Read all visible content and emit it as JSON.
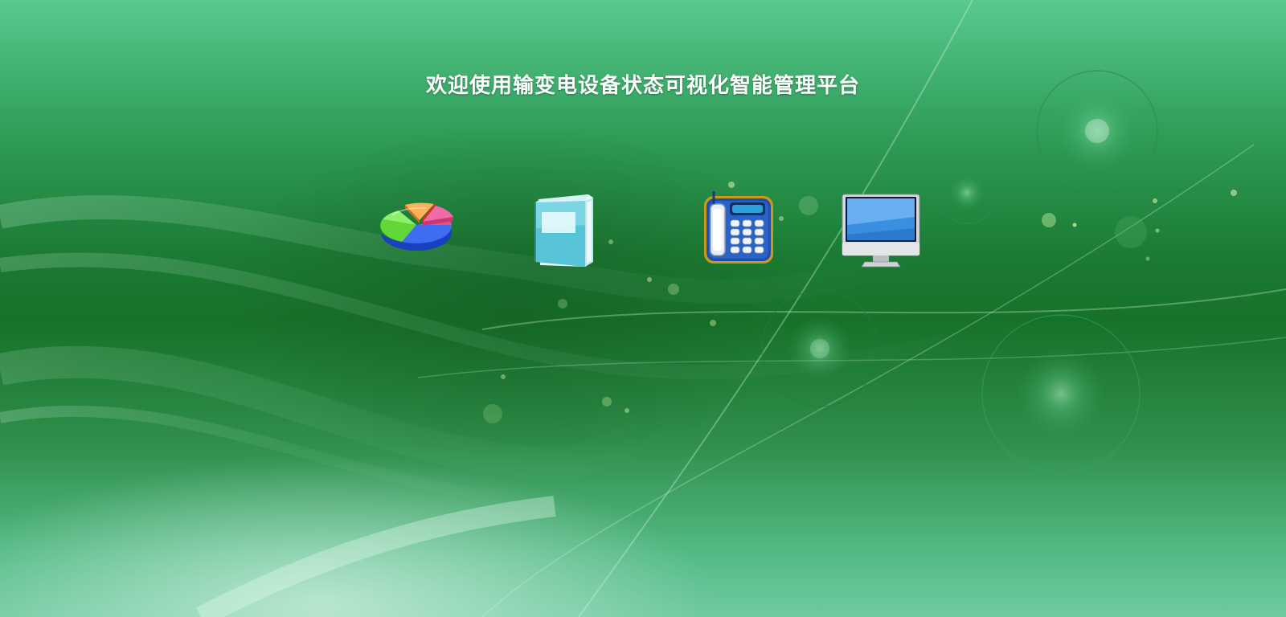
{
  "header": {
    "title": "欢迎使用输变电设备状态可视化智能管理平台"
  },
  "launcher": {
    "icons": [
      {
        "name": "pie-chart-icon"
      },
      {
        "name": "book-icon"
      },
      {
        "name": "telephone-icon"
      },
      {
        "name": "monitor-icon"
      }
    ]
  },
  "colors": {
    "background_light": "#58c98f",
    "background_dark": "#177229",
    "title_text": "#ffffff"
  }
}
